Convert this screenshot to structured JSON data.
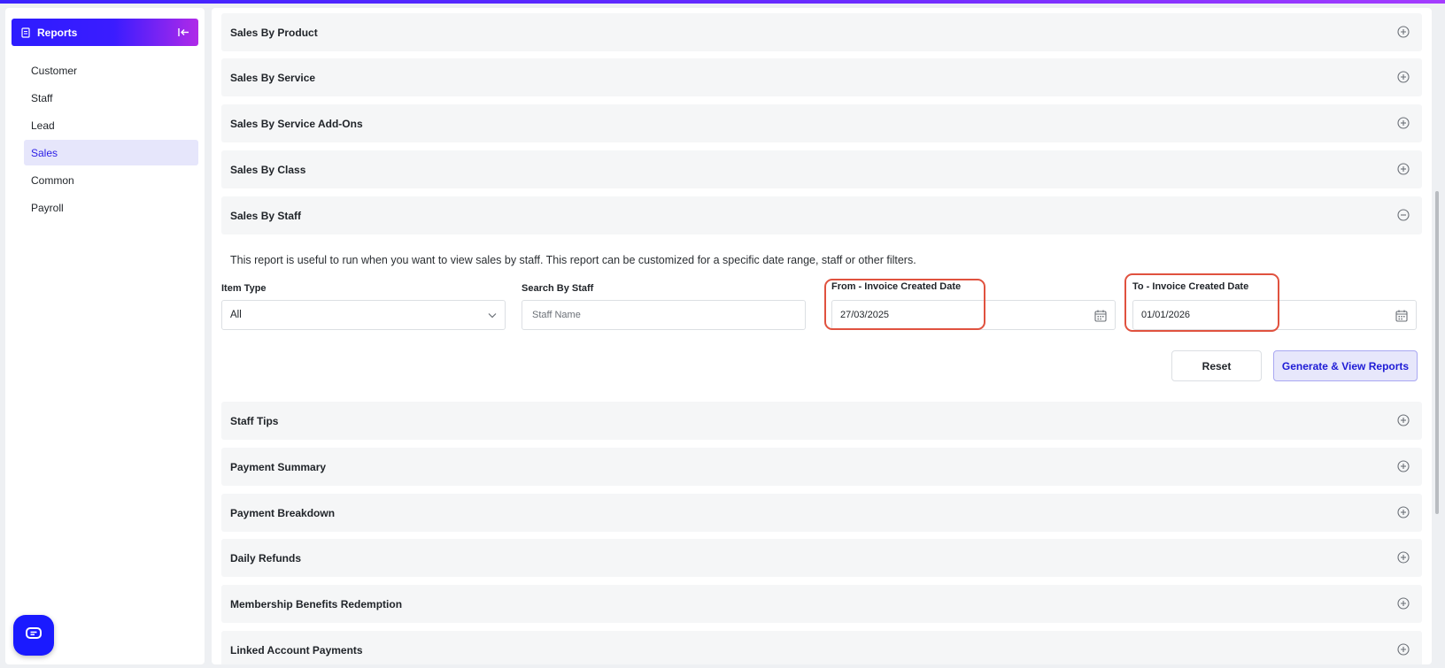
{
  "sidebar": {
    "title": "Reports",
    "items": [
      {
        "label": "Customer"
      },
      {
        "label": "Staff"
      },
      {
        "label": "Lead"
      },
      {
        "label": "Sales",
        "active": true
      },
      {
        "label": "Common"
      },
      {
        "label": "Payroll"
      }
    ]
  },
  "sections_top": [
    {
      "title": "Sales By Product"
    },
    {
      "title": "Sales By Service"
    },
    {
      "title": "Sales By Service Add-Ons"
    },
    {
      "title": "Sales By Class"
    }
  ],
  "expanded_section": {
    "title": "Sales By Staff",
    "description": "This report is useful to run when you want to view sales by staff. This report can be customized for a specific date range, staff or other filters.",
    "item_type": {
      "label": "Item Type",
      "value": "All"
    },
    "search_staff": {
      "label": "Search By Staff",
      "placeholder": "Staff Name"
    },
    "from_date": {
      "label": "From - Invoice Created Date",
      "value": "27/03/2025"
    },
    "to_date": {
      "label": "To - Invoice Created Date",
      "value": "01/01/2026"
    },
    "reset_label": "Reset",
    "generate_label": "Generate & View Reports"
  },
  "sections_bottom": [
    {
      "title": "Staff Tips"
    },
    {
      "title": "Payment Summary"
    },
    {
      "title": "Payment Breakdown"
    },
    {
      "title": "Daily Refunds"
    },
    {
      "title": "Membership Benefits Redemption"
    },
    {
      "title": "Linked Account Payments"
    }
  ],
  "colors": {
    "accent": "#2b1de6",
    "highlight": "#e0523f"
  },
  "icons": {
    "expand": "plus-circle-icon",
    "collapse": "minus-circle-icon",
    "calendar": "calendar-icon",
    "chat": "chat-icon"
  }
}
